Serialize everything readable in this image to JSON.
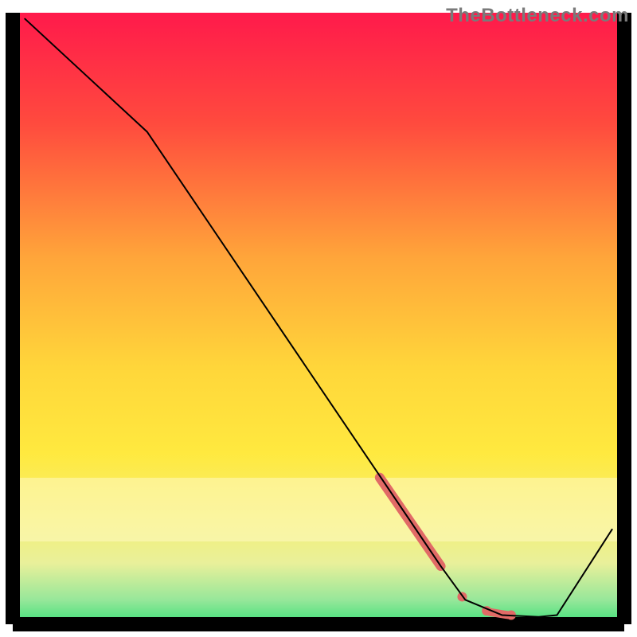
{
  "attribution": "TheBottleneck.com",
  "chart_data": {
    "type": "line",
    "title": "",
    "xlabel": "",
    "ylabel": "",
    "xlim": [
      0,
      100
    ],
    "ylim": [
      0,
      100
    ],
    "background_gradient": {
      "top": "#ff1a4b",
      "upper": "#ff5a3a",
      "mid_upper": "#ffb43a",
      "mid": "#ffe23a",
      "mid_lower": "#f6ee6c",
      "lower_overlay": "#fff9c2",
      "lower": "#e6f2a8",
      "bottom": "#3fe07a"
    },
    "axes_color": "#000000",
    "series": [
      {
        "name": "bottleneck-curve",
        "color": "#000000",
        "stroke_width": 2,
        "points": [
          {
            "x": 2.0,
            "y": 99.0
          },
          {
            "x": 22.0,
            "y": 80.5
          },
          {
            "x": 70.0,
            "y": 9.5
          },
          {
            "x": 74.0,
            "y": 4.0
          },
          {
            "x": 80.0,
            "y": 1.5
          },
          {
            "x": 86.0,
            "y": 1.2
          },
          {
            "x": 89.0,
            "y": 1.5
          },
          {
            "x": 98.0,
            "y": 15.5
          }
        ]
      }
    ],
    "markers": [
      {
        "name": "highlight-segment",
        "color": "#e16a66",
        "type": "thick-segment",
        "stroke_width": 12,
        "points": [
          {
            "x": 60.0,
            "y": 24.0
          },
          {
            "x": 70.0,
            "y": 9.5
          }
        ]
      },
      {
        "name": "highlight-dots",
        "color": "#e16a66",
        "type": "dots",
        "radius": 6,
        "points": [
          {
            "x": 73.5,
            "y": 4.5
          },
          {
            "x": 77.5,
            "y": 2.2
          },
          {
            "x": 81.5,
            "y": 1.5
          }
        ]
      },
      {
        "name": "highlight-short-segment",
        "color": "#e16a66",
        "type": "thick-segment",
        "stroke_width": 10,
        "points": [
          {
            "x": 78.0,
            "y": 2.0
          },
          {
            "x": 81.0,
            "y": 1.5
          }
        ]
      }
    ]
  }
}
